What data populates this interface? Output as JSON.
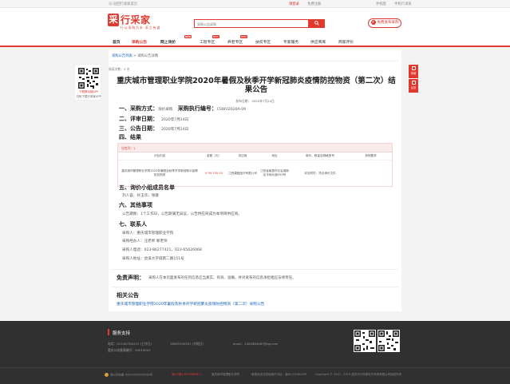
{
  "topbar": {
    "home": "返回行采家首页",
    "login": "请登录",
    "register": "免费注册",
    "mobile": "手机版",
    "app": "手机行采家"
  },
  "header": {
    "logo_char": "采",
    "logo_text": "行采家",
    "slogan": "行以采购为本 采之有道",
    "search_placeholder": "采购公告采购",
    "search_icon": "search-icon",
    "publish_button": "免费发布采购"
  },
  "nav": {
    "items": [
      {
        "label": "首页",
        "active": false,
        "bold": true
      },
      {
        "label": "采购公告",
        "active": true,
        "bold": true
      },
      {
        "label": "网上询价",
        "active": false,
        "bold": true,
        "badge": "NEW"
      },
      {
        "label": "工程专区",
        "active": false,
        "badge": "NEW"
      },
      {
        "label": "养老专区",
        "active": false,
        "badge": "NEW"
      },
      {
        "label": "扶贫专区",
        "active": false
      },
      {
        "label": "专家服务",
        "active": false
      },
      {
        "label": "供应商库",
        "active": false
      },
      {
        "label": "商家评价",
        "active": false
      }
    ]
  },
  "leftfloat": {
    "line1": "下载移动端APP",
    "line2": "扫码下载行采家APP"
  },
  "rightfloat": {
    "btn1": "商城",
    "btn2": "反馈"
  },
  "breadcrumb": {
    "part1": "采购公告列表",
    "separator": ">",
    "part2": "采购公告详情"
  },
  "meta": "阅读次数：3 次",
  "title": "重庆城市管理职业学院2020年暑假及秋季开学新冠肺炎疫情防控物资（第二次）结果公告",
  "pubdate": "发布日期： 2020年7月24日",
  "sections": {
    "s1_label": "一、采购方式：",
    "s1_value": "询价采购",
    "s1_code_label": "采购执行编号：",
    "s1_code_value": "CSWU2020A-09",
    "s2_label": "二、评审日期：",
    "s2_value": "2020年7月24日",
    "s3_label": "三、公告日期：",
    "s3_value": "2020年7月24日",
    "s4_label": "四、结果"
  },
  "table": {
    "header": "分包号：1",
    "columns": [
      "分包内容",
      "金额（元）",
      "供应商",
      "地址",
      "单价、数量及规格型号",
      "其他要求"
    ],
    "rows": [
      {
        "content": "重庆城市管理职业学院2020年暑假及秋季开学新冠肺炎疫情防控物资",
        "amount": "¥ 99,700.00",
        "supplier": "江西康鑫医疗有限公司",
        "address": "江西省南昌市红谷滩新区丰和大道555号",
        "spec": "详见附件：符合询价文件",
        "other": ""
      }
    ]
  },
  "s5": {
    "label": "五、询价小组成员名单",
    "members": "刘人容，孙玉华，张敬"
  },
  "s6": {
    "label": "六、其他事项",
    "text": "公告期限：1个工作日，公告期满无异议，公告供应商成为本项目供应商。"
  },
  "s7": {
    "label": "七、联系人",
    "lines": [
      "采购人：重庆城市管理职业学院",
      "采购经办人：汪老师 黎老师",
      "采购人电话：023-86277421，023-65626068",
      "采购人地址：虎溪大学城南二路151号"
    ]
  },
  "disclaimer": {
    "label": "免责声明：",
    "text": "采购人在本页面发布的任何信息应当真实、有效、准确，并对发布的信息承担相应法律责任。"
  },
  "related": {
    "label": "相关公告",
    "link": "重庆城市管理职业学院2020年暑假及秋季开学新冠肺炎疫情防控物资（第二次）采购公告"
  },
  "footer": {
    "title": "服务支持",
    "lines": [
      "电话：023-62760237 (工作日)",
      "重庆公安备案编号：50019003",
      "18083109501 (节假日)",
      "email：1462884487@qq.com"
    ],
    "bottom": {
      "beian": "渝公网安备 50019003000569号",
      "icp_prefix": "渝ICP备",
      "icp": "渝ICP备14009969号-1",
      "gov": "重庆城市管理职业学院",
      "tel": "增值电信业务经营许可证：渝B2-20160099",
      "copyright": "Copyright © 2015 - 2019 重庆市行采家电子商务有限公司版权所有"
    }
  }
}
